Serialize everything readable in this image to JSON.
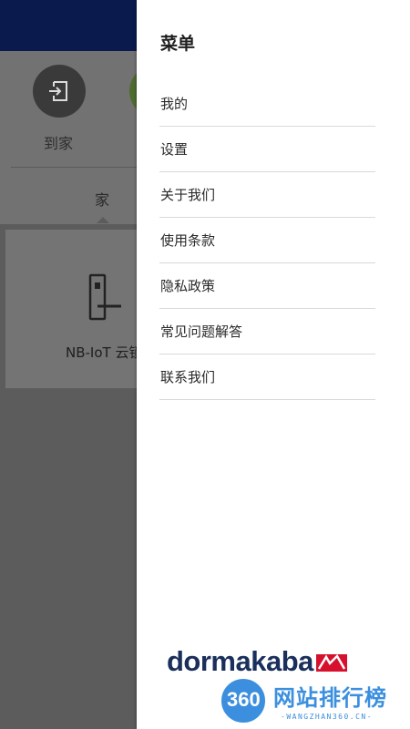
{
  "background": {
    "action_label": "到家",
    "tab_label": "家",
    "card_label": "NB-IoT 云锁"
  },
  "drawer": {
    "title": "菜单",
    "items": [
      {
        "label": "我的"
      },
      {
        "label": "设置"
      },
      {
        "label": "关于我们"
      },
      {
        "label": "使用条款"
      },
      {
        "label": "隐私政策"
      },
      {
        "label": "常见问题解答"
      },
      {
        "label": "联系我们"
      }
    ]
  },
  "brand": {
    "name": "dormakaba"
  },
  "watermark": {
    "badge": "360",
    "name": "网站排行榜",
    "url": "-WANGZHAN360.CN-"
  },
  "colors": {
    "status_bar": "#0a1a4d",
    "brand_navy": "#1a2f5b",
    "brand_red": "#d6112e",
    "watermark_blue": "#3b8fde"
  }
}
